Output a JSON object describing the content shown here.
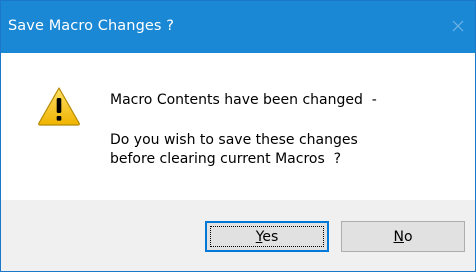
{
  "window": {
    "title": "Save Macro Changes ?",
    "close_icon": "close-icon"
  },
  "message": {
    "icon": "warning-icon",
    "line1": "Macro Contents have been changed  -",
    "line2": "Do you wish to save these changes",
    "line3": "before clearing current Macros  ?"
  },
  "buttons": {
    "yes_accel": "Y",
    "yes_rest": "es",
    "no_accel": "N",
    "no_rest": "o"
  },
  "colors": {
    "titlebar": "#1b88d6",
    "accent": "#0078d7",
    "warning": "#f5c518"
  }
}
